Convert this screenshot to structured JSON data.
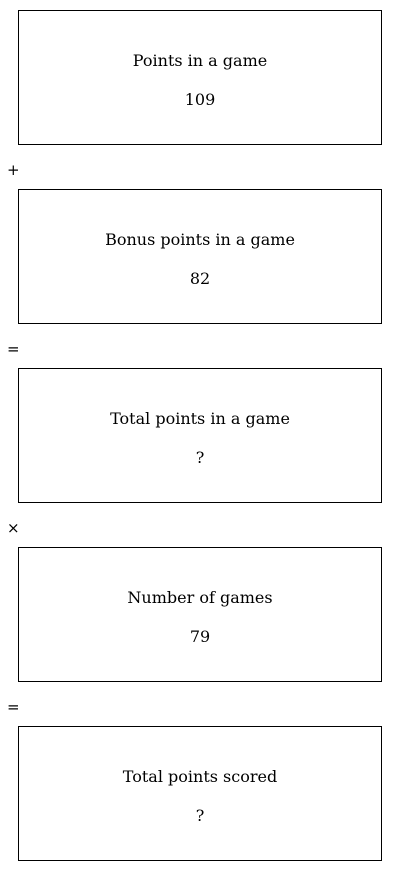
{
  "boxes": [
    {
      "label": "Points in a game",
      "value": "109"
    },
    {
      "label": "Bonus points in a game",
      "value": "82"
    },
    {
      "label": "Total points in a game",
      "value": "?"
    },
    {
      "label": "Number of games",
      "value": "79"
    },
    {
      "label": "Total points scored",
      "value": "?"
    }
  ],
  "operators": [
    "+",
    "=",
    "×",
    "="
  ]
}
